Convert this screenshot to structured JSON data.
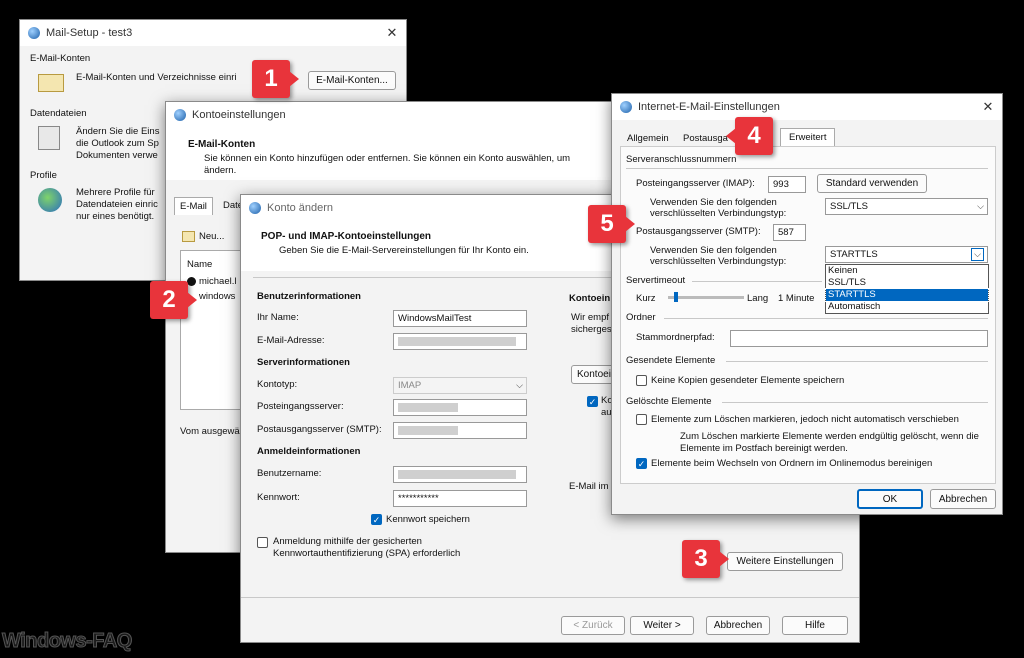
{
  "mailsetup": {
    "title": "Mail-Setup - test3",
    "section1": "E-Mail-Konten",
    "section1_text": "E-Mail-Konten und Verzeichnisse einri",
    "button": "E-Mail-Konten...",
    "section2": "Datendateien",
    "section2_text": [
      "Ändern Sie die Eins",
      "die Outlook zum Sp",
      "Dokumenten verwe"
    ],
    "section3": "Profile",
    "section3_text": [
      "Mehrere Profile für",
      "Datendateien einric",
      "nur eines benötigt."
    ]
  },
  "konto": {
    "title": "Kontoeinstellungen",
    "heading": "E-Mail-Konten",
    "desc": "Sie können ein Konto hinzufügen oder entfernen. Sie können ein Konto auswählen, um",
    "desc2": "ändern.",
    "tabs": [
      "E-Mail",
      "Date"
    ],
    "new_btn": "Neu...",
    "col_name": "Name",
    "rows": [
      "michael.l",
      "windows"
    ],
    "footer": "Vom ausgewä"
  },
  "aendern": {
    "title": "Konto ändern",
    "heading": "POP- und IMAP-Kontoeinstellungen",
    "subheading": "Geben Sie die E-Mail-Servereinstellungen für Ihr Konto ein.",
    "user_section": "Benutzerinformationen",
    "name_label": "Ihr Name:",
    "name_value": "WindowsMailTest",
    "email_label": "E-Mail-Adresse:",
    "server_section": "Serverinformationen",
    "type_label": "Kontotyp:",
    "type_value": "IMAP",
    "in_label": "Posteingangsserver:",
    "out_label": "Postausgangsserver (SMTP):",
    "login_section": "Anmeldeinformationen",
    "user_label": "Benutzername:",
    "pw_label": "Kennwort:",
    "pw_value": "***********",
    "save_pw": "Kennwort speichern",
    "spa": [
      "Anmeldung mithilfe der gesicherten",
      "Kennwortauthentifizierung (SPA) erforderlich"
    ],
    "right_heading": "Kontoein",
    "right_text": [
      "Wir empf",
      "sicherges"
    ],
    "right_btn": "Kontoei",
    "right_chk": [
      "Ko",
      "au"
    ],
    "right_email": "E-Mail im",
    "more_btn": "Weitere Einstellungen",
    "back_btn": "< Zurück",
    "next_btn": "Weiter >",
    "cancel_btn": "Abbrechen",
    "help_btn": "Hilfe"
  },
  "inet": {
    "title": "Internet-E-Mail-Einstellungen",
    "tabs": [
      "Allgemein",
      "Postausga",
      "Erweitert"
    ],
    "port_section": "Serveranschlussnummern",
    "imap_label": "Posteingangsserver (IMAP):",
    "imap_value": "993",
    "std_btn": "Standard verwenden",
    "enc_label": [
      "Verwenden Sie den folgenden",
      "verschlüsselten Verbindungstyp:"
    ],
    "enc_value": "SSL/TLS",
    "smtp_label": "Postausgangsserver (SMTP):",
    "smtp_value": "587",
    "enc2_value": "STARTTLS",
    "enc_options": [
      "Keinen",
      "SSL/TLS",
      "STARTTLS",
      "Automatisch"
    ],
    "timeout_section": "Servertimeout",
    "timeout_short": "Kurz",
    "timeout_long": "Lang",
    "timeout_value": "1 Minute",
    "folder_section": "Ordner",
    "root_label": "Stammordnerpfad:",
    "sent_section": "Gesendete Elemente",
    "sent_chk": "Keine Kopien gesendeter Elemente speichern",
    "deleted_section": "Gelöschte Elemente",
    "del_chk1": "Elemente zum Löschen markieren, jedoch nicht automatisch verschieben",
    "del_note": [
      "Zum Löschen markierte Elemente werden endgültig gelöscht, wenn die",
      "Elemente im Postfach bereinigt werden."
    ],
    "del_chk2": "Elemente beim Wechseln von Ordnern im Onlinemodus bereinigen",
    "ok_btn": "OK",
    "cancel_btn": "Abbrechen"
  },
  "badges": [
    "1",
    "2",
    "3",
    "4",
    "5"
  ],
  "watermark": "Windows-FAQ",
  "colors": {
    "badge": "#e8343b",
    "accent": "#0067c0"
  }
}
